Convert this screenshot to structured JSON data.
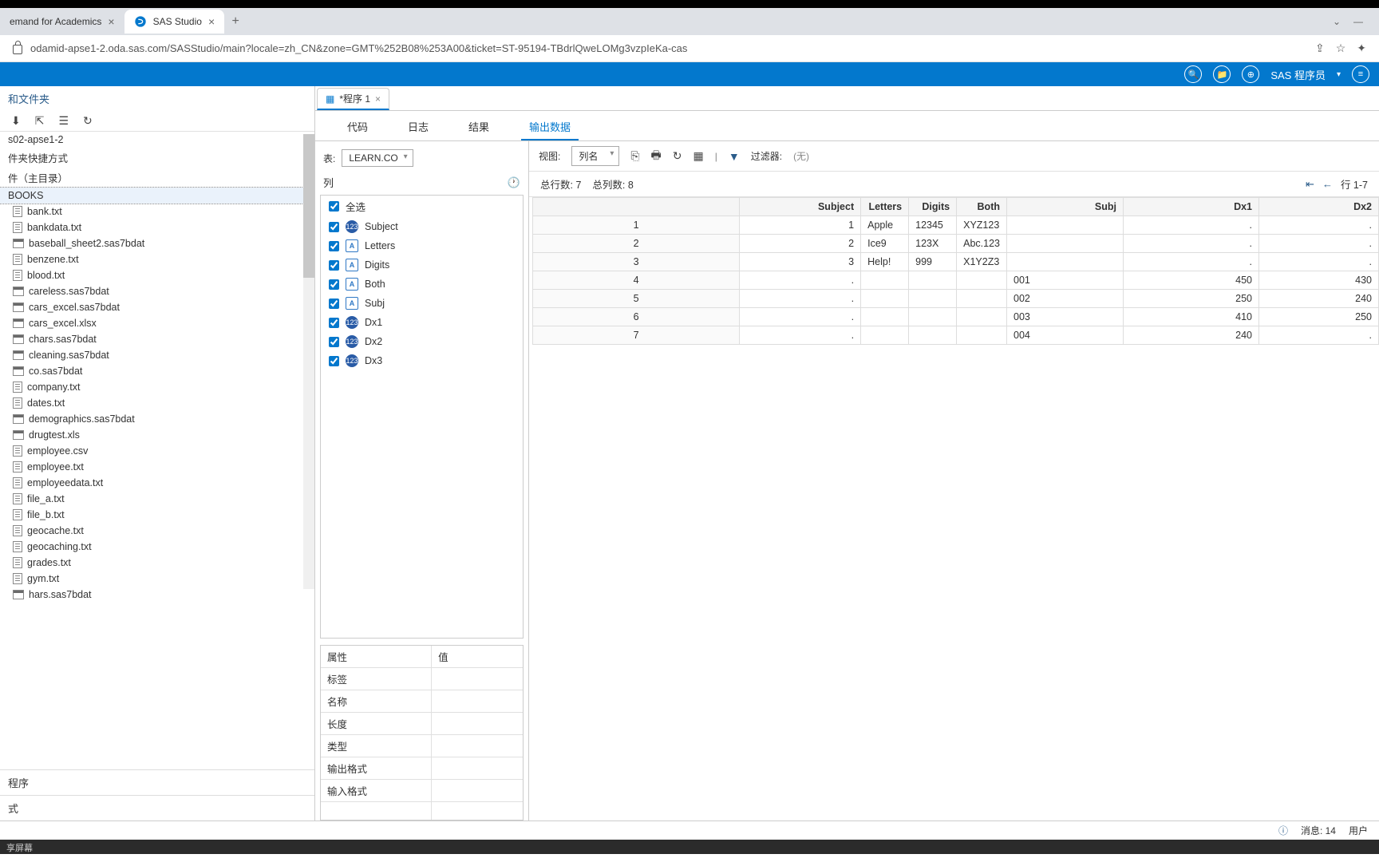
{
  "browser": {
    "tabs": [
      {
        "title": "emand for Academics",
        "active": false
      },
      {
        "title": "SAS Studio",
        "active": true
      }
    ],
    "url": "odamid-apse1-2.oda.sas.com/SASStudio/main?locale=zh_CN&zone=GMT%252B08%253A00&ticket=ST-95194-TBdrlQweLOMg3vzpIeKa-cas"
  },
  "sas_header": {
    "user_label": "SAS 程序员"
  },
  "sidebar": {
    "title": "和文件夹",
    "server": "s02-apse1-2",
    "shortcuts": "件夹快捷方式",
    "mainfolder": "件（主目录）",
    "selected_folder": "BOOKS",
    "files": [
      {
        "name": "bank.txt",
        "type": "txt"
      },
      {
        "name": "bankdata.txt",
        "type": "txt"
      },
      {
        "name": "baseball_sheet2.sas7bdat",
        "type": "sas"
      },
      {
        "name": "benzene.txt",
        "type": "txt"
      },
      {
        "name": "blood.txt",
        "type": "txt"
      },
      {
        "name": "careless.sas7bdat",
        "type": "sas"
      },
      {
        "name": "cars_excel.sas7bdat",
        "type": "sas"
      },
      {
        "name": "cars_excel.xlsx",
        "type": "sas"
      },
      {
        "name": "chars.sas7bdat",
        "type": "sas"
      },
      {
        "name": "cleaning.sas7bdat",
        "type": "sas"
      },
      {
        "name": "co.sas7bdat",
        "type": "sas"
      },
      {
        "name": "company.txt",
        "type": "txt"
      },
      {
        "name": "dates.txt",
        "type": "txt"
      },
      {
        "name": "demographics.sas7bdat",
        "type": "sas"
      },
      {
        "name": "drugtest.xls",
        "type": "sas"
      },
      {
        "name": "employee.csv",
        "type": "txt"
      },
      {
        "name": "employee.txt",
        "type": "txt"
      },
      {
        "name": "employeedata.txt",
        "type": "txt"
      },
      {
        "name": "file_a.txt",
        "type": "txt"
      },
      {
        "name": "file_b.txt",
        "type": "txt"
      },
      {
        "name": "geocache.txt",
        "type": "txt"
      },
      {
        "name": "geocaching.txt",
        "type": "txt"
      },
      {
        "name": "grades.txt",
        "type": "txt"
      },
      {
        "name": "gym.txt",
        "type": "txt"
      },
      {
        "name": "hars.sas7bdat",
        "type": "sas"
      }
    ],
    "footer1": "程序",
    "footer2": "式"
  },
  "program": {
    "tab_name": "*程序 1",
    "tabs": {
      "code": "代码",
      "log": "日志",
      "results": "结果",
      "output": "输出数据"
    }
  },
  "columns_panel": {
    "table_label": "表:",
    "table_value": "LEARN.CO",
    "view_label": "视图:",
    "view_value": "列名",
    "header": "列",
    "select_all": "全选",
    "columns": [
      {
        "name": "Subject",
        "type": "num"
      },
      {
        "name": "Letters",
        "type": "char"
      },
      {
        "name": "Digits",
        "type": "char"
      },
      {
        "name": "Both",
        "type": "char"
      },
      {
        "name": "Subj",
        "type": "char"
      },
      {
        "name": "Dx1",
        "type": "num"
      },
      {
        "name": "Dx2",
        "type": "num"
      },
      {
        "name": "Dx3",
        "type": "num"
      }
    ],
    "props": {
      "attr": "属性",
      "val": "值",
      "label": "标签",
      "name": "名称",
      "length": "长度",
      "type": "类型",
      "outfmt": "输出格式",
      "infmt": "输入格式"
    }
  },
  "data_panel": {
    "filter_label": "过滤器:",
    "filter_value": "(无)",
    "total_rows": "总行数: 7",
    "total_cols": "总列数: 8",
    "rows_range": "行 1-7",
    "headers": [
      "",
      "Subject",
      "Letters",
      "Digits",
      "Both",
      "Subj",
      "Dx1",
      "Dx2"
    ],
    "rows": [
      [
        "1",
        "1",
        "Apple",
        "12345",
        "XYZ123",
        "",
        ".",
        "."
      ],
      [
        "2",
        "2",
        "Ice9",
        "123X",
        "Abc.123",
        "",
        ".",
        "."
      ],
      [
        "3",
        "3",
        "Help!",
        "999",
        "X1Y2Z3",
        "",
        ".",
        "."
      ],
      [
        "4",
        ".",
        "",
        "",
        "",
        "001",
        "450",
        "430"
      ],
      [
        "5",
        ".",
        "",
        "",
        "",
        "002",
        "250",
        "240"
      ],
      [
        "6",
        ".",
        "",
        "",
        "",
        "003",
        "410",
        "250"
      ],
      [
        "7",
        ".",
        "",
        "",
        "",
        "004",
        "240",
        "."
      ]
    ]
  },
  "status": {
    "messages": "消息: 14",
    "user": "用户"
  },
  "bottom": "享屏幕"
}
